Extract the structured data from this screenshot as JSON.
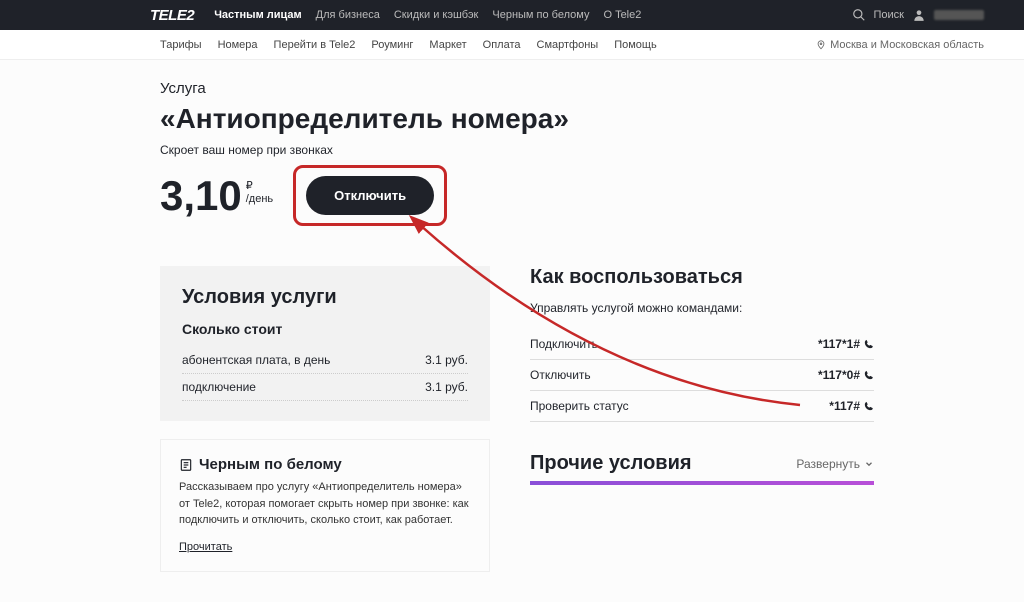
{
  "topbar": {
    "logo": "TELE2",
    "items": [
      "Частным лицам",
      "Для бизнеса",
      "Скидки и кэшбэк",
      "Черным по белому",
      "О Tele2"
    ],
    "search": "Поиск"
  },
  "subnav": {
    "items": [
      "Тарифы",
      "Номера",
      "Перейти в Tele2",
      "Роуминг",
      "Маркет",
      "Оплата",
      "Смартфоны",
      "Помощь"
    ],
    "region": "Москва и Московская область"
  },
  "page": {
    "breadcrumb": "Услуга",
    "title": "«Антиопределитель номера»",
    "subtitle": "Скроет ваш номер при звонках",
    "price_value": "3,10",
    "price_curr": "₽",
    "price_period": "/день",
    "button": "Отключить"
  },
  "terms": {
    "heading": "Условия услуги",
    "subheading": "Сколько стоит",
    "rows": [
      {
        "label": "абонентская плата, в день",
        "value": "3.1 руб."
      },
      {
        "label": "подключение",
        "value": "3.1 руб."
      }
    ]
  },
  "article": {
    "heading": "Черным по белому",
    "body": "Рассказываем про услугу «Антиопределитель номера» от Tele2, которая помогает скрыть номер при звонке: как подключить и отключить, сколько стоит, как работает.",
    "link": "Прочитать"
  },
  "howto": {
    "heading": "Как воспользоваться",
    "intro": "Управлять услугой можно командами:",
    "rows": [
      {
        "label": "Подключить",
        "code": "*117*1#"
      },
      {
        "label": "Отключить",
        "code": "*117*0#"
      },
      {
        "label": "Проверить статус",
        "code": "*117#"
      }
    ]
  },
  "other": {
    "heading": "Прочие условия",
    "expand": "Развернуть"
  }
}
